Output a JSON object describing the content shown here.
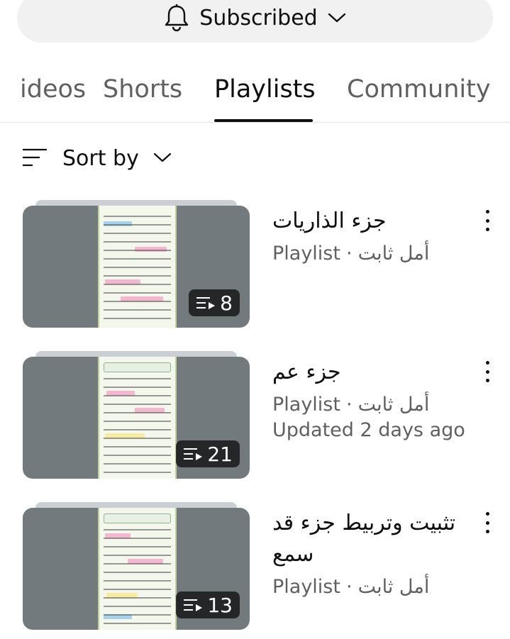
{
  "subscribe": {
    "label": "Subscribed",
    "icon": "bell-icon"
  },
  "tabs": [
    {
      "label": "Videos",
      "visible_text": "ideos",
      "active": false
    },
    {
      "label": "Shorts",
      "active": false
    },
    {
      "label": "Playlists",
      "active": true
    },
    {
      "label": "Community",
      "active": false
    }
  ],
  "sort": {
    "label": "Sort by"
  },
  "playlists": [
    {
      "title": "جزء الذاريات",
      "type": "Playlist",
      "channel": "أمل ثابت",
      "updated": "",
      "count": "8"
    },
    {
      "title": "جزء عم",
      "type": "Playlist",
      "channel": "أمل ثابت",
      "updated": "Updated 2 days ago",
      "count": "21"
    },
    {
      "title": "تثبيت وتربيط جزء قد سمع",
      "type": "Playlist",
      "channel": "أمل ثابت",
      "updated": "",
      "count": "13"
    }
  ],
  "colors": {
    "text_primary": "#0f0f0f",
    "text_secondary": "#606060",
    "pill_bg": "#f1f1f1"
  }
}
